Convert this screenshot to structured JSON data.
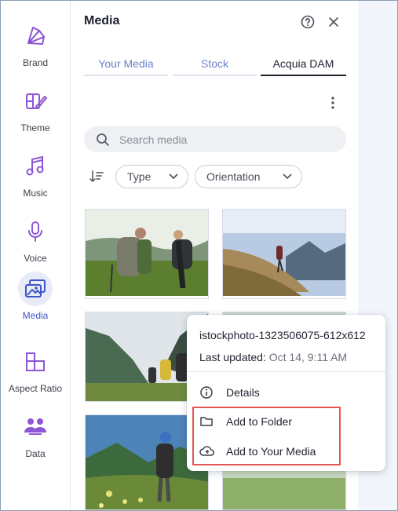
{
  "rail": {
    "items": [
      {
        "label": "Brand",
        "icon": "brand-palette-icon"
      },
      {
        "label": "Theme",
        "icon": "theme-icon"
      },
      {
        "label": "Music",
        "icon": "music-note-icon"
      },
      {
        "label": "Voice",
        "icon": "microphone-icon"
      },
      {
        "label": "Media",
        "icon": "media-images-icon",
        "active": true
      },
      {
        "label": "Aspect Ratio",
        "icon": "aspect-ratio-icon"
      },
      {
        "label": "Data",
        "icon": "data-users-icon"
      }
    ],
    "accent": "#3f55c8",
    "icon_color": "#8e55d6"
  },
  "panel": {
    "title": "Media",
    "tabs": [
      {
        "label": "Your Media"
      },
      {
        "label": "Stock"
      },
      {
        "label": "Acquia DAM",
        "active": true
      }
    ],
    "search": {
      "placeholder": "Search media"
    },
    "filters": {
      "type_label": "Type",
      "orientation_label": "Orientation"
    }
  },
  "context_menu": {
    "filename": "istockphoto-1323506075-612x612",
    "updated_label": "Last updated:",
    "updated_value": "Oct 14, 9:11 AM",
    "items": [
      {
        "label": "Details",
        "icon": "info-icon"
      },
      {
        "label": "Add to Folder",
        "icon": "folder-icon"
      },
      {
        "label": "Add to Your Media",
        "icon": "cloud-upload-icon"
      }
    ]
  }
}
